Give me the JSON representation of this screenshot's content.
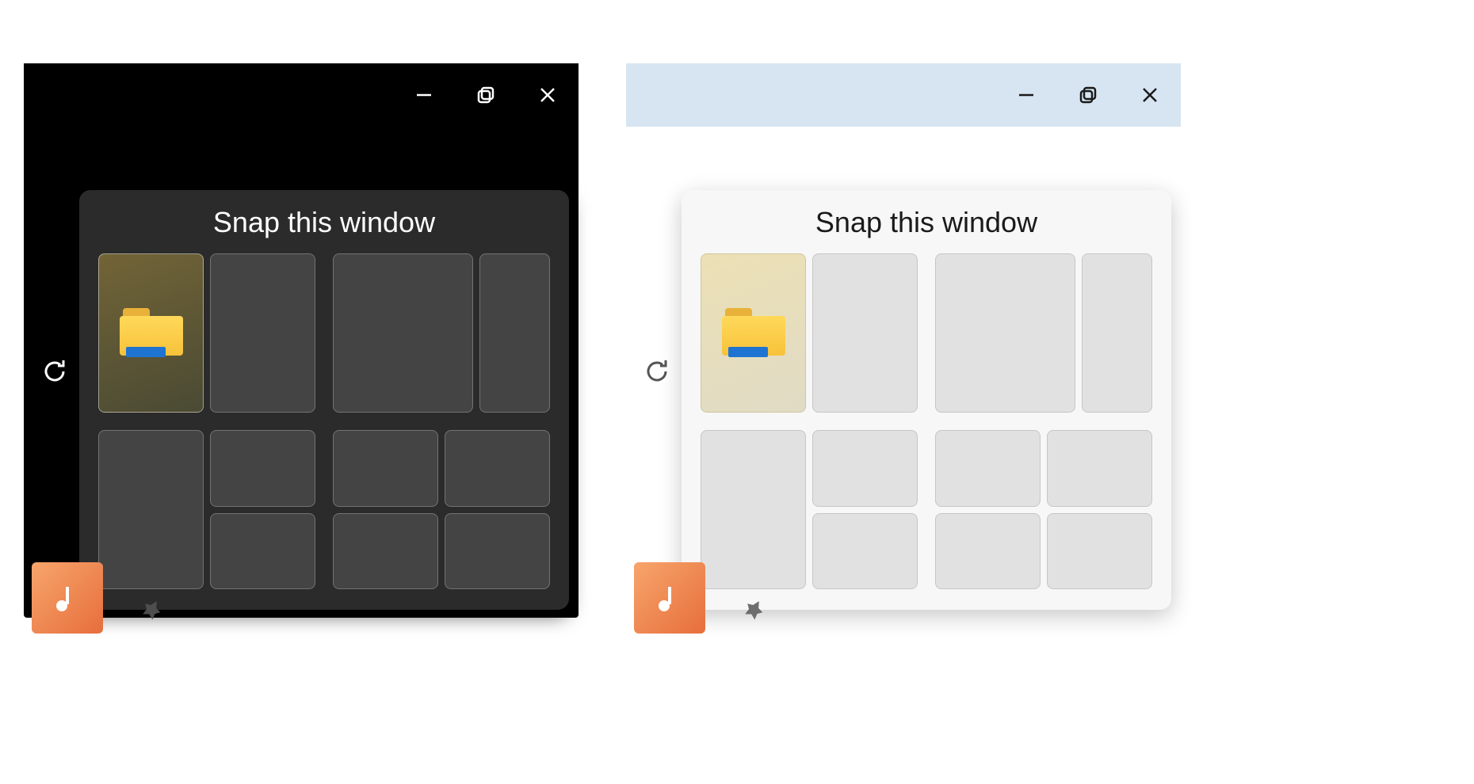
{
  "snap": {
    "title": "Snap this window",
    "selected_zone_app": "File Explorer"
  },
  "window_controls": {
    "minimize": "Minimize",
    "maximize": "Maximize",
    "close": "Close"
  },
  "themes": {
    "left": "dark",
    "right": "light"
  }
}
